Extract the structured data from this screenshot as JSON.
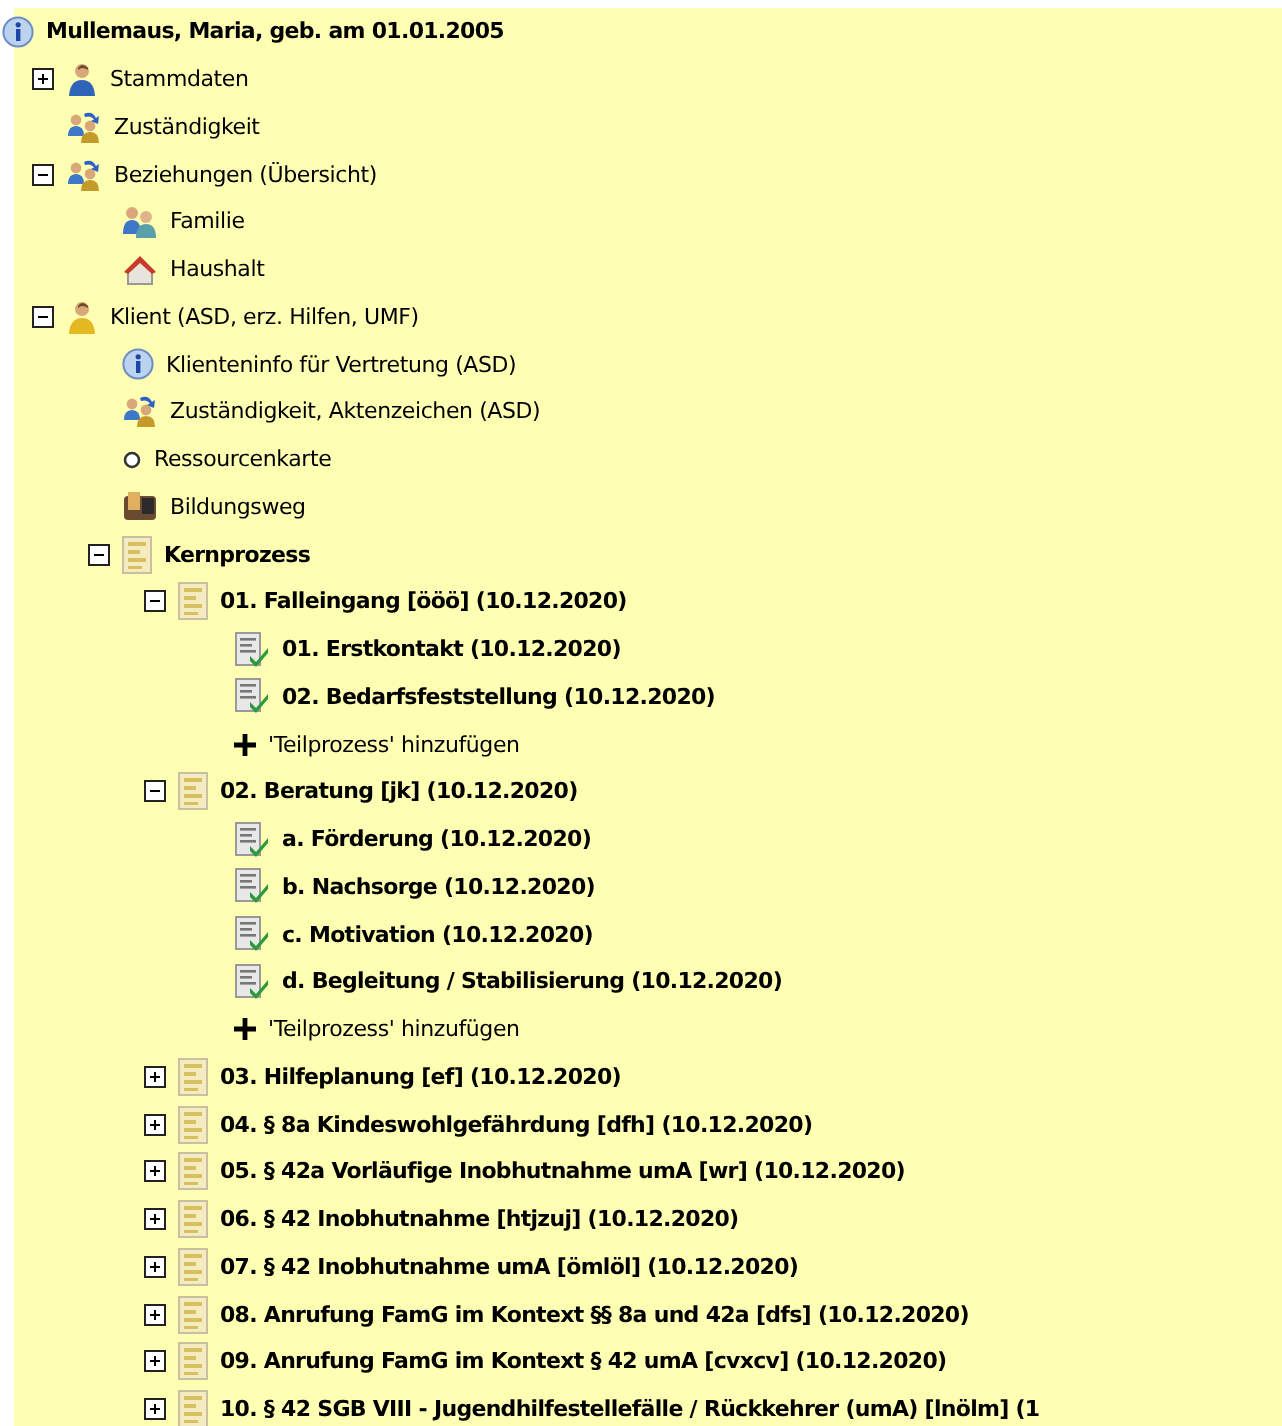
{
  "header": {
    "kind": "info",
    "text": "Mullemaus, Maria, geb. am 01.01.2005"
  },
  "tree": [
    {
      "kind": "person",
      "text": "Stammdaten",
      "bold": false,
      "expanded": false
    },
    {
      "kind": "group-arrows",
      "text": "Zuständigkeit",
      "bold": false
    },
    {
      "kind": "group-arrows",
      "text": "Beziehungen (Übersicht)",
      "bold": false,
      "expanded": true,
      "children": [
        {
          "kind": "family",
          "text": "Familie",
          "bold": false
        },
        {
          "kind": "house",
          "text": "Haushalt",
          "bold": false
        }
      ]
    },
    {
      "kind": "person-yellow",
      "text": "Klient (ASD, erz. Hilfen, UMF)",
      "bold": false,
      "expanded": true,
      "children": [
        {
          "kind": "info",
          "text": "Klienteninfo für Vertretung (ASD)",
          "bold": false
        },
        {
          "kind": "group-arrows",
          "text": "Zuständigkeit, Aktenzeichen (ASD)",
          "bold": false
        },
        {
          "kind": "circle",
          "text": "Ressourcenkarte",
          "bold": false
        },
        {
          "kind": "books",
          "text": "Bildungsweg",
          "bold": false
        },
        {
          "kind": "folder",
          "text": "Kernprozess",
          "bold": true,
          "expanded": true,
          "children": [
            {
              "kind": "folder",
              "text": "01. Falleingang [ööö] (10.12.2020)",
              "bold": true,
              "expanded": true,
              "children": [
                {
                  "kind": "doc-check",
                  "text": "01. Erstkontakt (10.12.2020)",
                  "bold": true
                },
                {
                  "kind": "doc-check",
                  "text": "02. Bedarfsfeststellung (10.12.2020)",
                  "bold": true
                },
                {
                  "kind": "plus",
                  "text": "'Teilprozess' hinzufügen",
                  "bold": false
                }
              ]
            },
            {
              "kind": "folder",
              "text": "02. Beratung [jk] (10.12.2020)",
              "bold": true,
              "expanded": true,
              "children": [
                {
                  "kind": "doc-check",
                  "text": "a. Förderung (10.12.2020)",
                  "bold": true
                },
                {
                  "kind": "doc-check",
                  "text": "b. Nachsorge (10.12.2020)",
                  "bold": true
                },
                {
                  "kind": "doc-check",
                  "text": "c. Motivation (10.12.2020)",
                  "bold": true
                },
                {
                  "kind": "doc-check",
                  "text": "d. Begleitung / Stabilisierung (10.12.2020)",
                  "bold": true
                },
                {
                  "kind": "plus",
                  "text": "'Teilprozess' hinzufügen",
                  "bold": false
                }
              ]
            },
            {
              "kind": "folder",
              "text": "03. Hilfeplanung [ef] (10.12.2020)",
              "bold": true,
              "expanded": false
            },
            {
              "kind": "folder",
              "text": "04. § 8a Kindeswohlgefährdung [dfh] (10.12.2020)",
              "bold": true,
              "expanded": false
            },
            {
              "kind": "folder",
              "text": "05. § 42a Vorläufige Inobhutnahme umA [wr] (10.12.2020)",
              "bold": true,
              "expanded": false
            },
            {
              "kind": "folder",
              "text": "06. § 42 Inobhutnahme [htjzuj] (10.12.2020)",
              "bold": true,
              "expanded": false
            },
            {
              "kind": "folder",
              "text": "07. § 42 Inobhutnahme umA [ömlöl] (10.12.2020)",
              "bold": true,
              "expanded": false
            },
            {
              "kind": "folder",
              "text": "08. Anrufung FamG im Kontext §§ 8a und 42a [dfs] (10.12.2020)",
              "bold": true,
              "expanded": false
            },
            {
              "kind": "folder",
              "text": "09. Anrufung FamG im Kontext § 42 umA [cvxcv] (10.12.2020)",
              "bold": true,
              "expanded": false
            },
            {
              "kind": "folder",
              "text": "10. § 42 SGB VIII - Jugendhilfestellefälle / Rückkehrer (umA) [lnölm] (1",
              "bold": true,
              "expanded": false
            }
          ]
        }
      ]
    }
  ]
}
